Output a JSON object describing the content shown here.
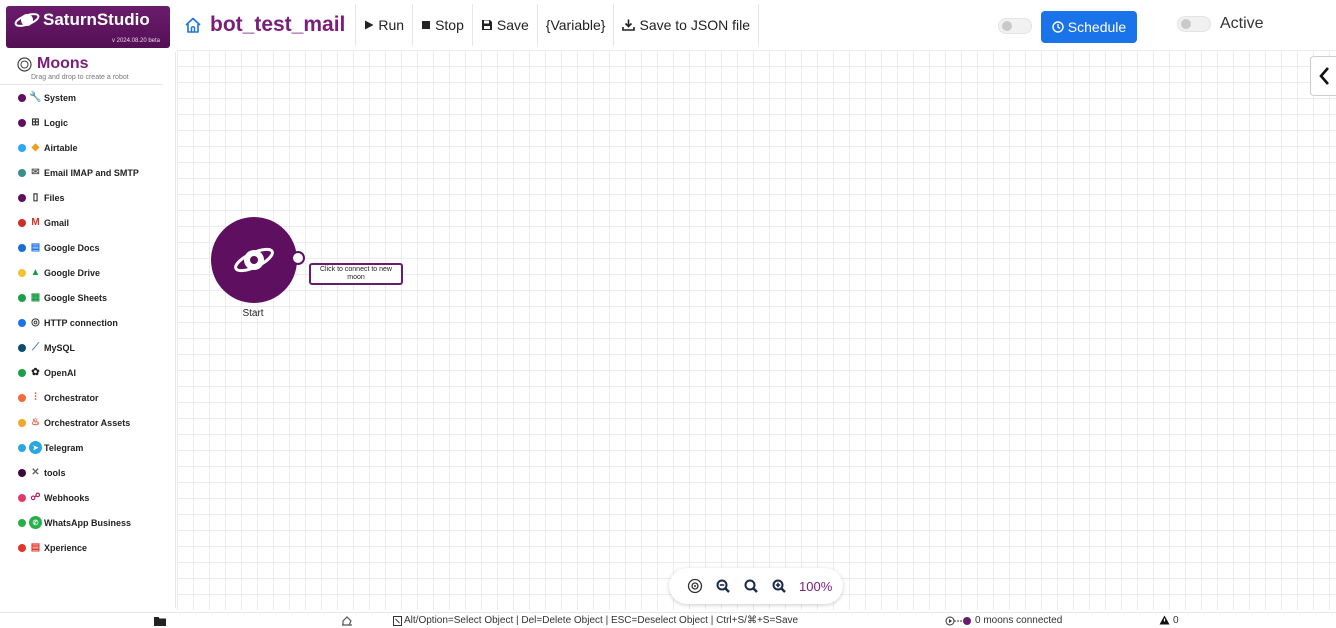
{
  "brand": {
    "name": "SaturnStudio",
    "version": "v 2024.08.20 beta"
  },
  "colors": {
    "brand": "#6a1c6c",
    "accent": "#1a73e8",
    "node": "#5f0f5f"
  },
  "toolbar": {
    "bot_name": "bot_test_mail",
    "run": "Run",
    "stop": "Stop",
    "save": "Save",
    "variable": "{Variable}",
    "save_json": "Save to JSON file",
    "schedule": "Schedule",
    "active": "Active"
  },
  "sidebar": {
    "title": "Moons",
    "subtitle": "Drag and drop to create a robot",
    "categories": [
      {
        "label": "System",
        "dot": "#5f0f5f",
        "icon": "wrench-icon"
      },
      {
        "label": "Logic",
        "dot": "#5f0f5f",
        "icon": "logic-icon"
      },
      {
        "label": "Airtable",
        "dot": "#2aa7f5",
        "icon": "airtable-icon"
      },
      {
        "label": "Email IMAP and SMTP",
        "dot": "#3a8f8a",
        "icon": "email-icon"
      },
      {
        "label": "Files",
        "dot": "#5f0f5f",
        "icon": "file-icon"
      },
      {
        "label": "Gmail",
        "dot": "#c9302c",
        "icon": "gmail-icon"
      },
      {
        "label": "Google Docs",
        "dot": "#1a6fd6",
        "icon": "google-docs-icon"
      },
      {
        "label": "Google Drive",
        "dot": "#f2c230",
        "icon": "google-drive-icon"
      },
      {
        "label": "Google Sheets",
        "dot": "#1e9e48",
        "icon": "google-sheets-icon"
      },
      {
        "label": "HTTP connection",
        "dot": "#1a73e8",
        "icon": "globe-icon"
      },
      {
        "label": "MySQL",
        "dot": "#0b4f6c",
        "icon": "mysql-icon"
      },
      {
        "label": "OpenAI",
        "dot": "#1e9e48",
        "icon": "openai-icon"
      },
      {
        "label": "Orchestrator",
        "dot": "#f26b3a",
        "icon": "orchestrator-icon"
      },
      {
        "label": "Orchestrator Assets",
        "dot": "#f2a62c",
        "icon": "assets-icon"
      },
      {
        "label": "Telegram",
        "dot": "#2aa7e0",
        "icon": "telegram-icon"
      },
      {
        "label": "tools",
        "dot": "#3b0a3b",
        "icon": "tools-icon"
      },
      {
        "label": "Webhooks",
        "dot": "#e03a6a",
        "icon": "webhooks-icon"
      },
      {
        "label": "WhatsApp Business",
        "dot": "#25b04a",
        "icon": "whatsapp-icon"
      },
      {
        "label": "Xperience",
        "dot": "#e5332a",
        "icon": "xperience-icon"
      }
    ]
  },
  "canvas": {
    "start_label": "Start",
    "connect_tip": "Click to connect to new moon",
    "zoom": "100%"
  },
  "status": {
    "shortcuts": "Alt/Option=Select Object | Del=Delete Object | ESC=Deselect Object | Ctrl+S/⌘+S=Save",
    "moons_connected": "0 moons connected",
    "warnings": "0"
  }
}
